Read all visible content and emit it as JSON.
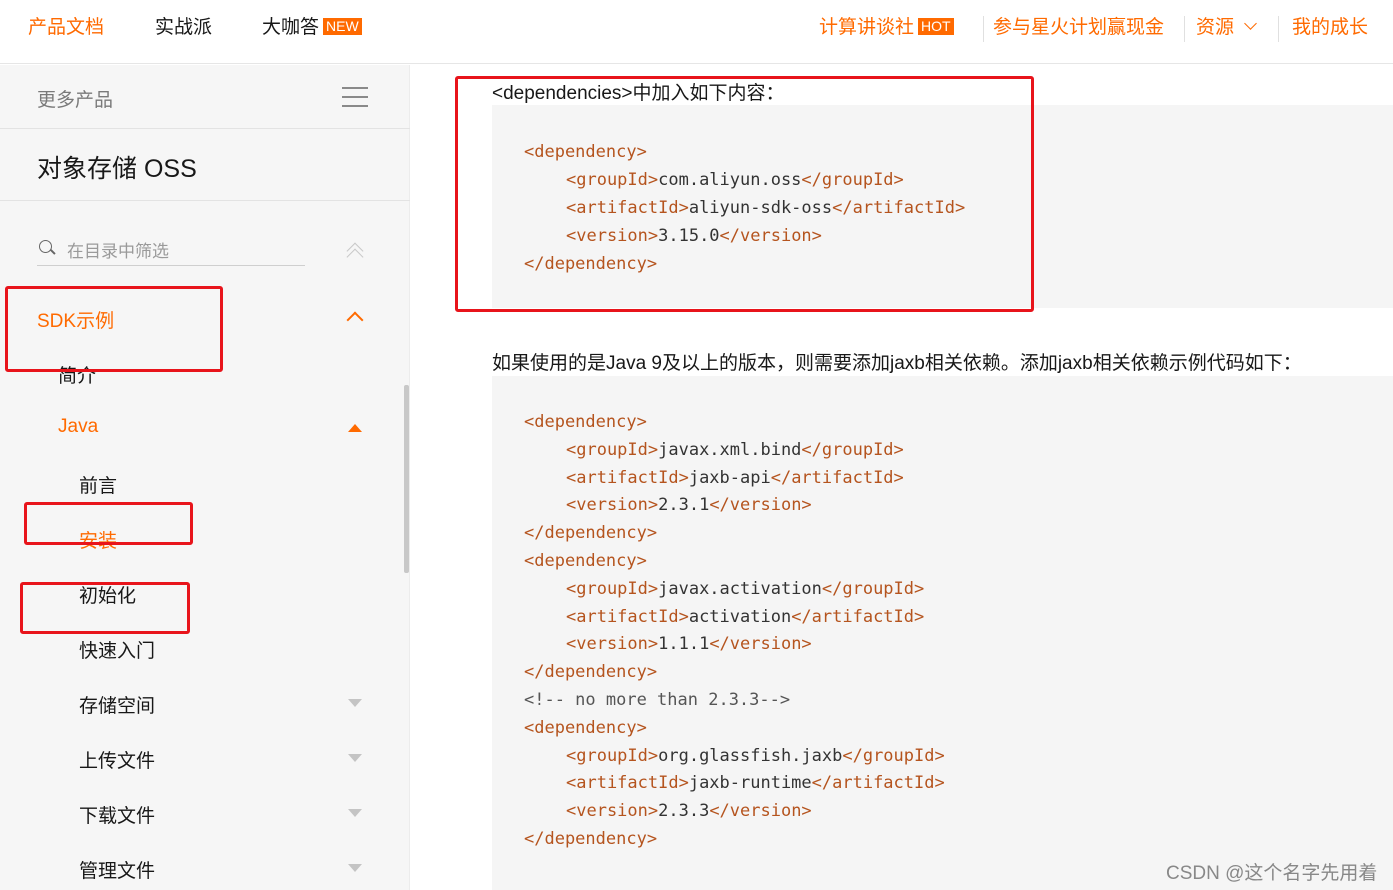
{
  "top_nav": {
    "product_docs": "产品文档",
    "practice": "实战派",
    "qa": "大咖答",
    "qa_badge": "NEW",
    "compute_talk": "计算讲谈社",
    "compute_badge": "HOT",
    "spark_plan": "参与星火计划赢现金",
    "resources": "资源",
    "my_growth": "我的成长",
    "accent_color": "#ff6a00"
  },
  "sidebar": {
    "more_products": "更多产品",
    "product_title": "对象存储 OSS",
    "filter_placeholder": "在目录中筛选",
    "items": [
      {
        "label": "SDK示例",
        "state": "expanded",
        "level": 1
      },
      {
        "label": "简介",
        "level": 2
      },
      {
        "label": "Java",
        "state": "expanded",
        "level": 2
      },
      {
        "label": "前言",
        "level": 3
      },
      {
        "label": "安装",
        "level": 3,
        "active": true
      },
      {
        "label": "初始化",
        "level": 3
      },
      {
        "label": "快速入门",
        "level": 3
      },
      {
        "label": "存储空间",
        "level": 3,
        "state": "collapsed"
      },
      {
        "label": "上传文件",
        "level": 3,
        "state": "collapsed"
      },
      {
        "label": "下载文件",
        "level": 3,
        "state": "collapsed"
      },
      {
        "label": "管理文件",
        "level": 3,
        "state": "collapsed"
      }
    ]
  },
  "content": {
    "para1": "<dependencies>中加入如下内容：",
    "code1": [
      {
        "tag_open": "<dependency>",
        "text": "",
        "tag_close": ""
      },
      {
        "tag_open": "<groupId>",
        "text": "com.aliyun.oss",
        "tag_close": "</groupId>"
      },
      {
        "tag_open": "<artifactId>",
        "text": "aliyun-sdk-oss",
        "tag_close": "</artifactId>"
      },
      {
        "tag_open": "<version>",
        "text": "3.15.0",
        "tag_close": "</version>"
      },
      {
        "tag_open": "</dependency>",
        "text": "",
        "tag_close": ""
      }
    ],
    "para2": "如果使用的是Java 9及以上的版本，则需要添加jaxb相关依赖。添加jaxb相关依赖示例代码如下：",
    "code2": [
      {
        "tag_open": "<dependency>",
        "text": "",
        "tag_close": ""
      },
      {
        "tag_open": "<groupId>",
        "text": "javax.xml.bind",
        "tag_close": "</groupId>"
      },
      {
        "tag_open": "<artifactId>",
        "text": "jaxb-api",
        "tag_close": "</artifactId>"
      },
      {
        "tag_open": "<version>",
        "text": "2.3.1",
        "tag_close": "</version>"
      },
      {
        "tag_open": "</dependency>",
        "text": "",
        "tag_close": ""
      },
      {
        "tag_open": "<dependency>",
        "text": "",
        "tag_close": ""
      },
      {
        "tag_open": "<groupId>",
        "text": "javax.activation",
        "tag_close": "</groupId>"
      },
      {
        "tag_open": "<artifactId>",
        "text": "activation",
        "tag_close": "</artifactId>"
      },
      {
        "tag_open": "<version>",
        "text": "1.1.1",
        "tag_close": "</version>"
      },
      {
        "tag_open": "</dependency>",
        "text": "",
        "tag_close": ""
      },
      {
        "comment": "<!-- no more than 2.3.3-->"
      },
      {
        "tag_open": "<dependency>",
        "text": "",
        "tag_close": ""
      },
      {
        "tag_open": "<groupId>",
        "text": "org.glassfish.jaxb",
        "tag_close": "</groupId>"
      },
      {
        "tag_open": "<artifactId>",
        "text": "jaxb-runtime",
        "tag_close": "</artifactId>"
      },
      {
        "tag_open": "<version>",
        "text": "2.3.3",
        "tag_close": "</version>"
      },
      {
        "tag_open": "</dependency>",
        "text": "",
        "tag_close": ""
      }
    ]
  },
  "watermark": "CSDN @这个名字先用着",
  "annotation_color": "#e8141b"
}
